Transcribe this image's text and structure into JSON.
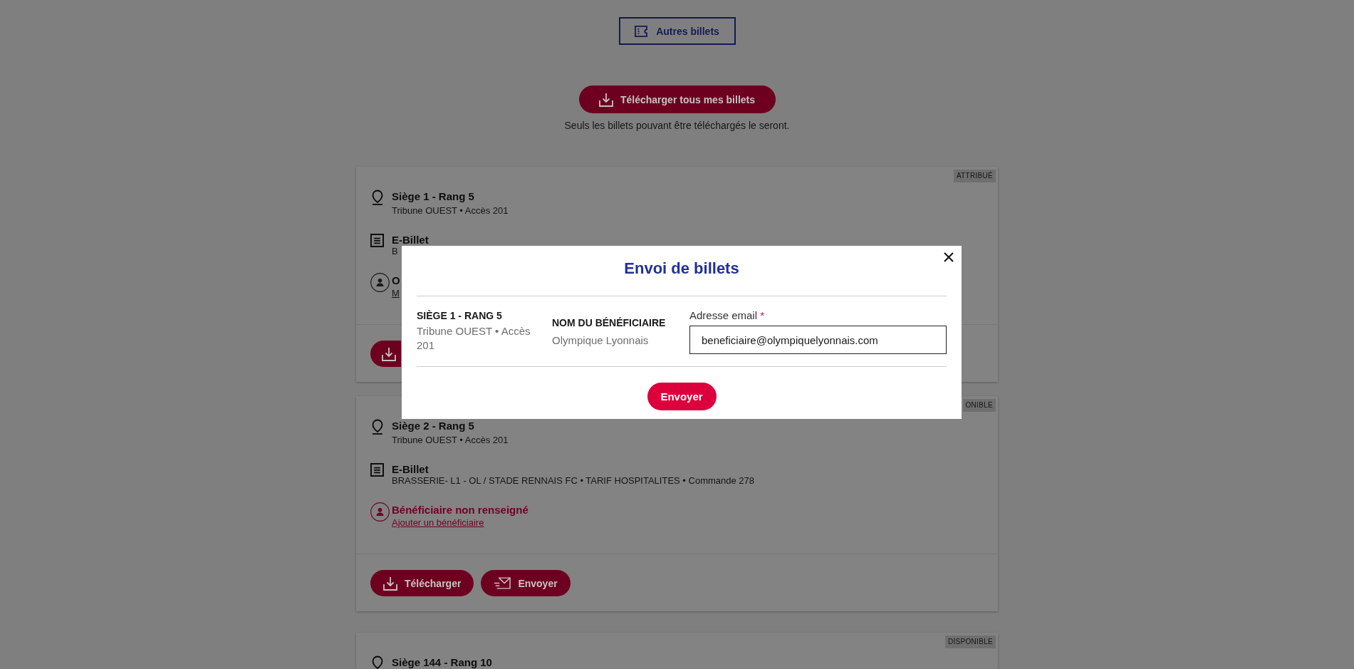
{
  "toolbar": {
    "other_tickets": "Autres billets",
    "download_all": "Télécharger tous mes billets",
    "download_note": "Seuls les billets pouvant être téléchargés le seront."
  },
  "ticket_groups": [
    {
      "tickets": [
        {
          "status": "ATTRIBUÉ",
          "seat": "Siège 1 - Rang 5",
          "location": "Tribune OUEST • Accès 201",
          "ticket_type": "E-Billet",
          "ticket_detail": "B",
          "beneficiary": {
            "missing": false,
            "name": "O",
            "link": "M"
          },
          "actions": [
            {
              "kind": "download"
            }
          ]
        },
        {
          "status": "ONIBLE",
          "seat": "Siège 2 - Rang 5",
          "location": "Tribune OUEST • Accès 201",
          "ticket_type": "E-Billet",
          "ticket_detail": "BRASSERIE- L1 - OL / STADE RENNAIS FC • TARIF HOSPITALITES • Commande 278",
          "beneficiary": {
            "missing": true,
            "name": "Bénéficiaire non renseigné",
            "link": "Ajouter un bénéficiaire"
          },
          "actions": [
            {
              "kind": "download",
              "label": "Télécharger"
            },
            {
              "kind": "send",
              "label": "Envoyer"
            }
          ]
        }
      ]
    },
    {
      "tickets": [
        {
          "status": "DISPONIBLE",
          "seat": "Siège 144 - Rang 10"
        }
      ]
    }
  ],
  "modal": {
    "title": "Envoi de billets",
    "seat_heading": "SIÈGE 1 - RANG 5",
    "seat_location": "Tribune OUEST • Accès 201",
    "beneficiary_heading": "NOM DU BÉNÉFICIAIRE",
    "beneficiary_name": "Olympique Lyonnais",
    "email": {
      "label": "Adresse email",
      "required_mark": "*",
      "value": "beneficiaire@olympiquelyonnais.com"
    },
    "submit": "Envoyer"
  }
}
